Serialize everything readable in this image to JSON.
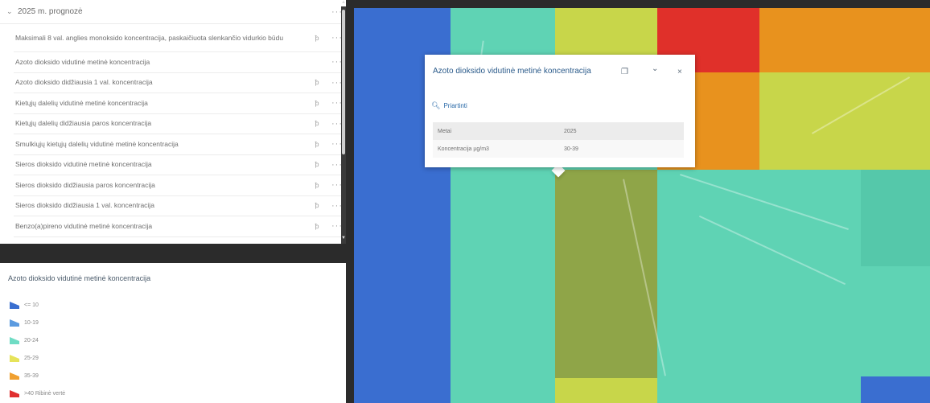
{
  "layers": {
    "group_title": "2025 m. prognozė",
    "group_menu": "···",
    "items": [
      {
        "label": "Maksimali 8 val. anglies monoksido koncentracija, paskaičiuota slenkančio vidurkio būdu",
        "vis": "ꝥ",
        "menu": "···"
      },
      {
        "label": "Azoto dioksido vidutinė metinė koncentracija",
        "vis": "",
        "menu": "···"
      },
      {
        "label": "Azoto dioksido didžiausia 1 val. koncentracija",
        "vis": "ꝥ",
        "menu": "···"
      },
      {
        "label": "Kietųjų dalelių vidutinė metinė koncentracija",
        "vis": "ꝥ",
        "menu": "···"
      },
      {
        "label": "Kietųjų dalelių didžiausia paros koncentracija",
        "vis": "ꝥ",
        "menu": "···"
      },
      {
        "label": "Smulkiųjų kietųjų dalelių vidutinė metinė koncentracija",
        "vis": "ꝥ",
        "menu": "···"
      },
      {
        "label": "Sieros dioksido vidutinė metinė koncentracija",
        "vis": "ꝥ",
        "menu": "···"
      },
      {
        "label": "Sieros dioksido didžiausia paros koncentracija",
        "vis": "ꝥ",
        "menu": "···"
      },
      {
        "label": "Sieros dioksido didžiausia 1 val. koncentracija",
        "vis": "ꝥ",
        "menu": "···"
      },
      {
        "label": "Benzo(a)pireno vidutinė metinė koncentracija",
        "vis": "ꝥ",
        "menu": "···"
      }
    ]
  },
  "legend": {
    "title": "Azoto dioksido vidutinė metinė koncentracija",
    "items": [
      {
        "label": "<= 10",
        "color": "#3a6fd0"
      },
      {
        "label": "10-19",
        "color": "#5b9be0"
      },
      {
        "label": "20-24",
        "color": "#6fdcc4"
      },
      {
        "label": "25-29",
        "color": "#e6e35a"
      },
      {
        "label": "35-39",
        "color": "#f0a030"
      },
      {
        "label": ">40 Ribinė vertė",
        "color": "#e03030"
      }
    ]
  },
  "popup": {
    "title": "Azoto dioksido vidutinė metinė koncentracija",
    "dock_icon": "❐",
    "collapse_icon": "⌄",
    "close_icon": "×",
    "zoom_label": "Priartinti",
    "rows": [
      {
        "key": "Metai",
        "value": "2025"
      },
      {
        "key": "Koncentracija µg/m3",
        "value": "30-39"
      }
    ]
  },
  "colors": {
    "blue": "#3a6ed0",
    "teal": "#5fd3b4",
    "yellow": "#c8d64a",
    "red": "#e0302a",
    "orange": "#e8921e",
    "olive": "#8fa548"
  }
}
